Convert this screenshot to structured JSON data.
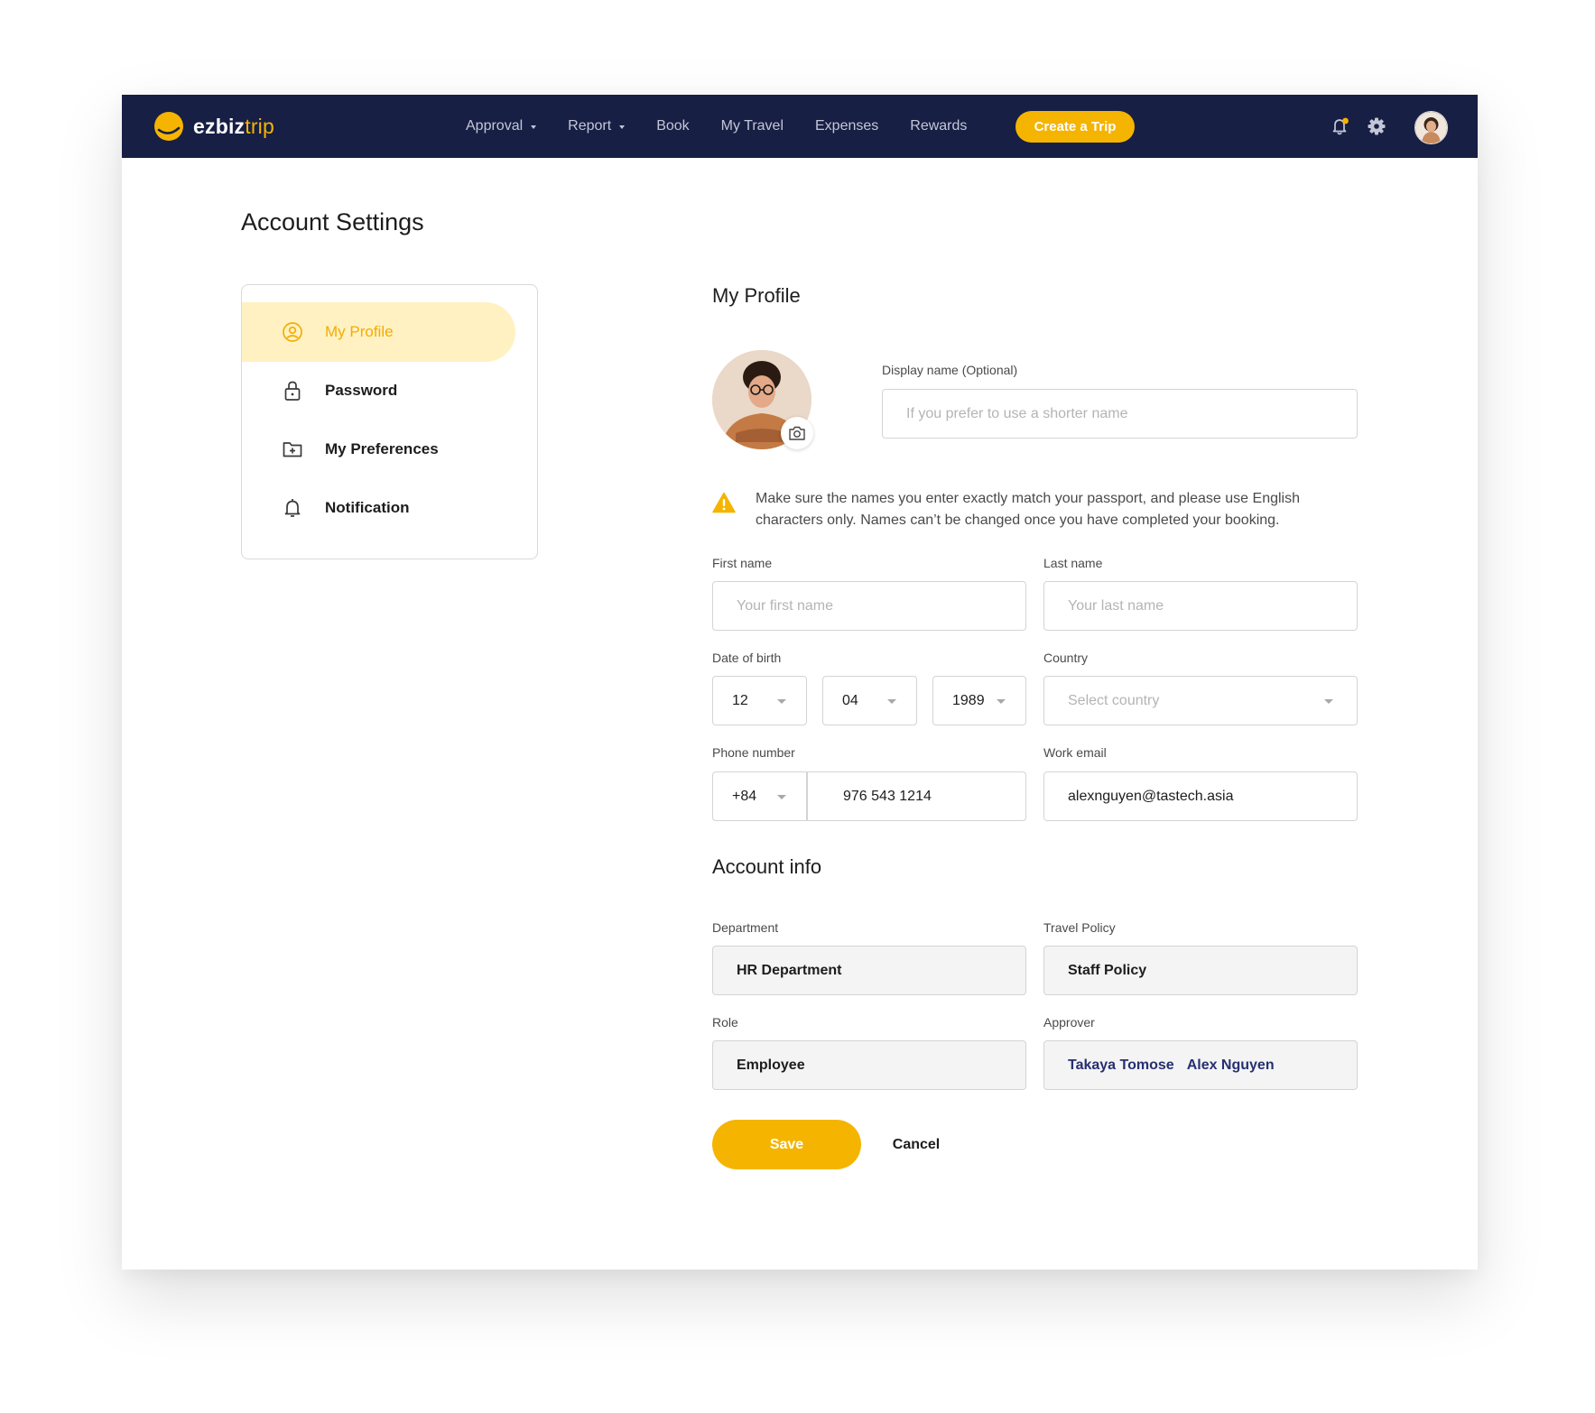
{
  "brand": {
    "name_primary": "ezbiz",
    "name_accent": "trip",
    "accent_color": "#f5b400",
    "nav_bg": "#171f45"
  },
  "nav": {
    "links": [
      {
        "label": "Approval",
        "has_dropdown": true
      },
      {
        "label": "Report",
        "has_dropdown": true
      },
      {
        "label": "Book",
        "has_dropdown": false
      },
      {
        "label": "My Travel",
        "has_dropdown": false
      },
      {
        "label": "Expenses",
        "has_dropdown": false
      },
      {
        "label": "Rewards",
        "has_dropdown": false
      }
    ],
    "cta_label": "Create a Trip",
    "icons": [
      "bell-icon",
      "gear-icon",
      "user-avatar"
    ]
  },
  "page_title": "Account Settings",
  "sidebar": {
    "items": [
      {
        "label": "My Profile",
        "icon": "user-circle-icon",
        "active": true
      },
      {
        "label": "Password",
        "icon": "lock-icon",
        "active": false
      },
      {
        "label": "My Preferences",
        "icon": "folder-plus-icon",
        "active": false
      },
      {
        "label": "Notification",
        "icon": "bell-icon",
        "active": false
      }
    ]
  },
  "profile": {
    "title": "My Profile",
    "display_name": {
      "label": "Display name (Optional)",
      "placeholder": "If you prefer to use a shorter name",
      "value": ""
    },
    "warning": "Make sure the names you enter exactly match your passport, and please use English characters only. Names can’t be changed once you have completed your booking.",
    "first_name": {
      "label": "First name",
      "placeholder": "Your first name",
      "value": ""
    },
    "last_name": {
      "label": "Last name",
      "placeholder": "Your last name",
      "value": ""
    },
    "dob": {
      "label": "Date of birth",
      "day": "12",
      "month": "04",
      "year": "1989"
    },
    "country": {
      "label": "Country",
      "placeholder": "Select country"
    },
    "phone": {
      "label": "Phone number",
      "code": "+84",
      "number": "976 543 1214"
    },
    "email": {
      "label": "Work email",
      "value": "alexnguyen@tastech.asia"
    }
  },
  "account_info": {
    "title": "Account info",
    "department": {
      "label": "Department",
      "value": "HR Department"
    },
    "travel_policy": {
      "label": "Travel Policy",
      "value": "Staff Policy"
    },
    "role": {
      "label": "Role",
      "value": "Employee"
    },
    "approver": {
      "label": "Approver",
      "names": [
        "Takaya Tomose",
        "Alex Nguyen"
      ]
    }
  },
  "actions": {
    "save": "Save",
    "cancel": "Cancel"
  }
}
